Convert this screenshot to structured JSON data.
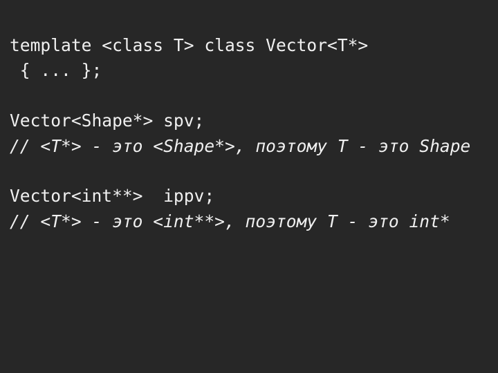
{
  "slide": {
    "background_color": "#272727",
    "text_color": "#f0f0f0",
    "language": "cpp",
    "lines": [
      {
        "id": "line-1",
        "kind": "code",
        "text": "template <class T> class Vector<T*>"
      },
      {
        "id": "line-2",
        "kind": "code",
        "text": " { ... };"
      },
      {
        "id": "line-3",
        "kind": "blank",
        "text": " "
      },
      {
        "id": "line-4",
        "kind": "code",
        "text": "Vector<Shape*> spv;"
      },
      {
        "id": "line-5",
        "kind": "comment",
        "text": "// <T*> - это <Shape*>, поэтому T - это Shape"
      },
      {
        "id": "line-6",
        "kind": "blank",
        "text": " "
      },
      {
        "id": "line-7",
        "kind": "code",
        "text": "Vector<int**>  ippv;"
      },
      {
        "id": "line-8",
        "kind": "comment",
        "text": "// <T*> - это <int**>, поэтому T - это int*"
      }
    ]
  }
}
